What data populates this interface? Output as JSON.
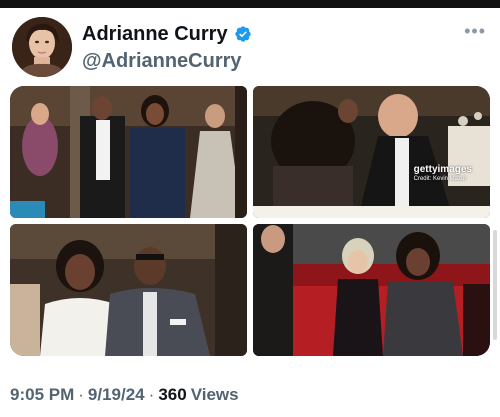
{
  "profile": {
    "display_name": "Adrianne Curry",
    "handle": "@AdrianneCurry",
    "verified": true,
    "verified_color": "#1d9bf0"
  },
  "menu": {
    "more_label": "•••"
  },
  "media": {
    "photos": [
      {
        "name": "photo-gala-group"
      },
      {
        "name": "photo-dinner-table",
        "watermark_brand": "gettyimages",
        "watermark_credit": "Credit: Kevin Mazur"
      },
      {
        "name": "photo-oprah-diddy"
      },
      {
        "name": "photo-red-couch"
      }
    ]
  },
  "meta": {
    "time": "9:05 PM",
    "separator": "·",
    "date": "9/19/24",
    "views_count": "360",
    "views_label": "Views"
  }
}
